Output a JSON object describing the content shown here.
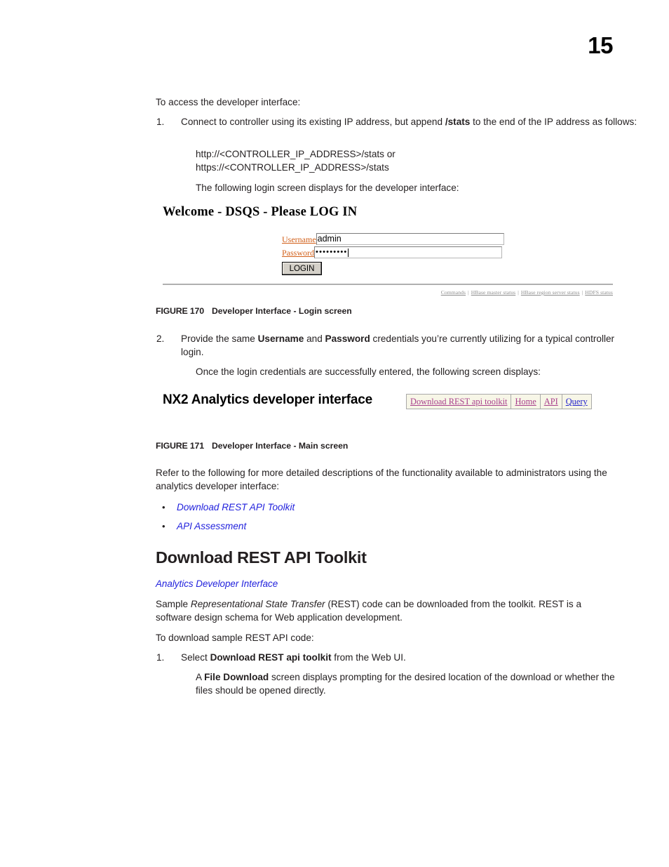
{
  "page": {
    "folio": "15"
  },
  "intro": {
    "lead": "To access the developer interface:"
  },
  "step1": {
    "num": "1.",
    "text_a": "Connect to controller using its existing IP address, but append ",
    "bold": "/stats",
    "text_b": " to the end of the IP address as follows:",
    "url_line1": "http://<CONTROLLER_IP_ADDRESS>/stats or",
    "url_line2": "https://<CONTROLLER_IP_ADDRESS>/stats",
    "follow": "The following login screen displays for the developer interface:"
  },
  "login_figure": {
    "title": "Welcome - DSQS - Please LOG IN",
    "username_label": "Username",
    "username_value": "admin",
    "password_label": "Password",
    "password_value": "•••••••••",
    "login_button": "LOGIN",
    "footer_links": [
      "Commands",
      "HBase master status",
      "HBase region server status",
      "HDFS status"
    ],
    "footer_separator": "|"
  },
  "caption170": {
    "number": "FIGURE 170",
    "title": "Developer Interface - Login screen"
  },
  "step2": {
    "num": "2.",
    "text_a": "Provide the same ",
    "bold_a": "Username",
    "text_b": " and ",
    "bold_b": "Password",
    "text_c": " credentials you’re currently utilizing for a typical controller login.",
    "follow": "Once the login credentials are successfully entered, the following screen displays:"
  },
  "main_figure": {
    "title": "NX2 Analytics developer interface",
    "nav": [
      {
        "label": "Download REST api toolkit",
        "color": "magenta"
      },
      {
        "label": "Home",
        "color": "magenta"
      },
      {
        "label": "API",
        "color": "magenta"
      },
      {
        "label": "Query",
        "color": "blue"
      }
    ]
  },
  "caption171": {
    "number": "FIGURE 171",
    "title": "Developer Interface - Main screen"
  },
  "refer": {
    "text": "Refer to the following for more detailed descriptions of the functionality available to administrators using the analytics developer interface:"
  },
  "bullets": [
    {
      "bullet": "•",
      "label": "Download REST API Toolkit"
    },
    {
      "bullet": "•",
      "label": "API Assessment"
    }
  ],
  "section": {
    "heading": "Download REST API Toolkit",
    "xref": "Analytics Developer Interface",
    "para_a": "Sample ",
    "para_italic": "Representational State Transfer",
    "para_b": " (REST) code can be downloaded from the toolkit. REST is a software design schema for Web application development.",
    "lead": "To download sample REST API code:"
  },
  "step_dl": {
    "num": "1.",
    "text_a": "Select ",
    "bold": "Download REST api toolkit",
    "text_b": " from the Web UI.",
    "sub_a": "A ",
    "sub_bold": "File Download",
    "sub_b": " screen displays prompting for the desired location of the download or whether the files should be opened directly."
  },
  "colors": {
    "link_blue": "#2222dd",
    "nav_magenta": "#a83f8c",
    "nav_blue": "#2222cc",
    "field_label_orange": "#d2601a",
    "footer_gray": "#8d8d8d",
    "nav_bg": "#f7f6e7"
  }
}
